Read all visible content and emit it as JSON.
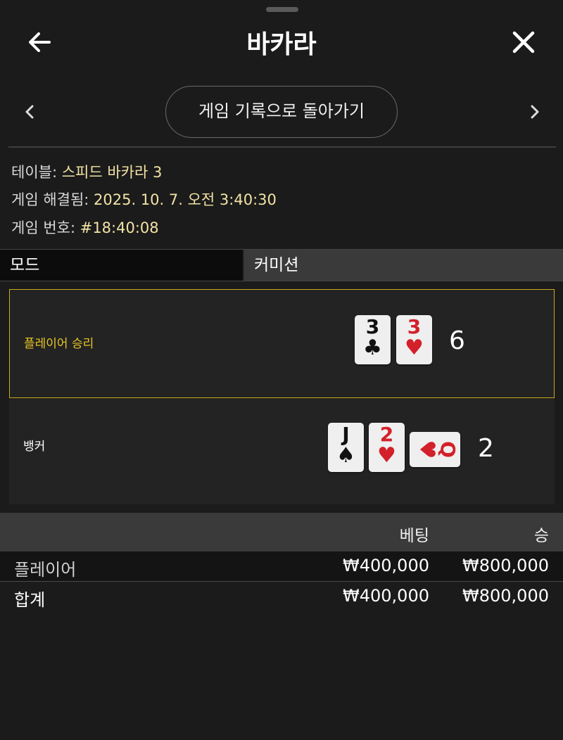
{
  "header": {
    "title": "바카라"
  },
  "nav": {
    "history_button": "게임 기록으로 돌아가기"
  },
  "info": {
    "table_label": "테이블: ",
    "table_value": "스피드 바카라 3",
    "resolved_label": "게임 해결됨: ",
    "resolved_value": "2025. 10. 7. 오전 3:40:30",
    "game_no_label": "게임 번호: ",
    "game_no_value": "#18:40:08"
  },
  "tabs": {
    "mode": "모드",
    "commission": "커미션"
  },
  "player": {
    "label": "플레이어 승리",
    "score": "6",
    "cards": [
      {
        "rank": "3",
        "suit": "♣",
        "color": "black"
      },
      {
        "rank": "3",
        "suit": "♥",
        "color": "red"
      }
    ]
  },
  "banker": {
    "label": "뱅커",
    "score": "2",
    "cards": [
      {
        "rank": "J",
        "suit": "♠",
        "color": "black"
      },
      {
        "rank": "2",
        "suit": "♥",
        "color": "red"
      },
      {
        "rank": "Q",
        "suit": "♥",
        "color": "red",
        "rotated": true
      }
    ]
  },
  "bets_table": {
    "headers": {
      "bet": "베팅",
      "win": "승"
    },
    "rows": [
      {
        "label": "플레이어",
        "bet": "₩400,000",
        "win": "₩800,000"
      },
      {
        "label": "합계",
        "bet": "₩400,000",
        "win": "₩800,000"
      }
    ]
  },
  "icons": {
    "back": "arrow-left-icon",
    "close": "close-icon",
    "prev": "chevron-left-icon",
    "next": "chevron-right-icon"
  },
  "colors": {
    "accent_yellow": "#e8c623",
    "info_value": "#f2e3a6",
    "card_red": "#d3202a",
    "background": "#1b1b1b"
  }
}
